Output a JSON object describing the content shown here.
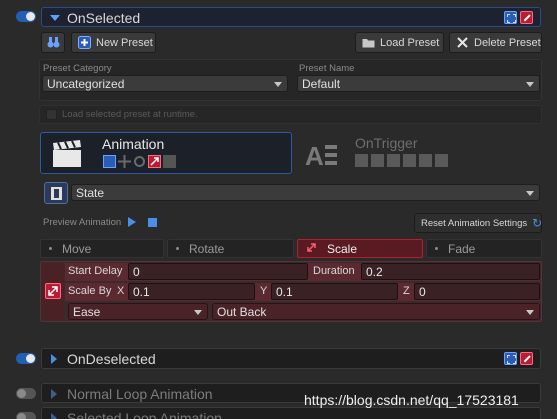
{
  "on_selected": {
    "title": "OnSelected"
  },
  "toolbar": {
    "new_preset": "New Preset",
    "load_preset": "Load Preset",
    "delete_preset": "Delete Preset"
  },
  "preset_category": {
    "label": "Preset Category",
    "value": "Uncategorized"
  },
  "preset_name": {
    "label": "Preset Name",
    "value": "Default"
  },
  "load_runtime": {
    "label": "Load selected preset at runtime."
  },
  "modules": {
    "animation": {
      "label": "Animation"
    },
    "ontrigger": {
      "label": "OnTrigger"
    }
  },
  "state": {
    "value": "State"
  },
  "preview": {
    "label": "Preview Animation",
    "reset": "Reset Animation Settings"
  },
  "tabs": [
    "Move",
    "Rotate",
    "Scale",
    "Fade"
  ],
  "selected_tab": "Scale",
  "scale": {
    "start_delay_label": "Start Delay",
    "start_delay": "0",
    "duration_label": "Duration",
    "duration": "0.2",
    "scale_by_label": "Scale By",
    "x_label": "X",
    "x": "0.1",
    "y_label": "Y",
    "y": "0.1",
    "z_label": "Z",
    "z": "0",
    "ease_type": "Ease",
    "ease": "Out Back"
  },
  "on_deselected": {
    "title": "OnDeselected"
  },
  "normal_loop": {
    "title": "Normal Loop Animation"
  },
  "selected_loop": {
    "title": "Selected Loop Animation"
  },
  "watermark": "https://blog.csdn.net/qq_17523181",
  "colors": {
    "accent_blue": "#2b5db5",
    "accent_red": "#b81d35",
    "scale_panel": "#5a2a30"
  }
}
